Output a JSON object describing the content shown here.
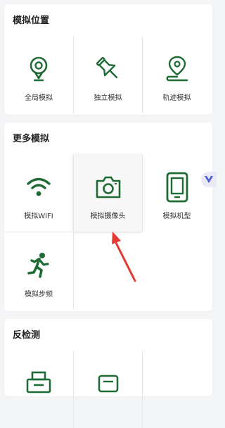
{
  "sections": {
    "simulate_location": {
      "title": "模拟位置",
      "items": [
        {
          "label": "全局模拟",
          "icon": "map-pin-bubble-icon"
        },
        {
          "label": "独立模拟",
          "icon": "pushpin-icon"
        },
        {
          "label": "轨迹模拟",
          "icon": "route-pin-icon"
        }
      ]
    },
    "more_simulation": {
      "title": "更多模拟",
      "items": [
        {
          "label": "模拟WIFI",
          "icon": "wifi-icon"
        },
        {
          "label": "模拟摄像头",
          "icon": "camera-icon"
        },
        {
          "label": "模拟机型",
          "icon": "tablet-icon"
        },
        {
          "label": "模拟步频",
          "icon": "running-person-icon"
        }
      ]
    },
    "anti_detection": {
      "title": "反检测"
    }
  },
  "colors": {
    "icon_green": "#1e6b35",
    "annotation_red": "#e53935",
    "badge_blue": "#4a5ad8"
  }
}
